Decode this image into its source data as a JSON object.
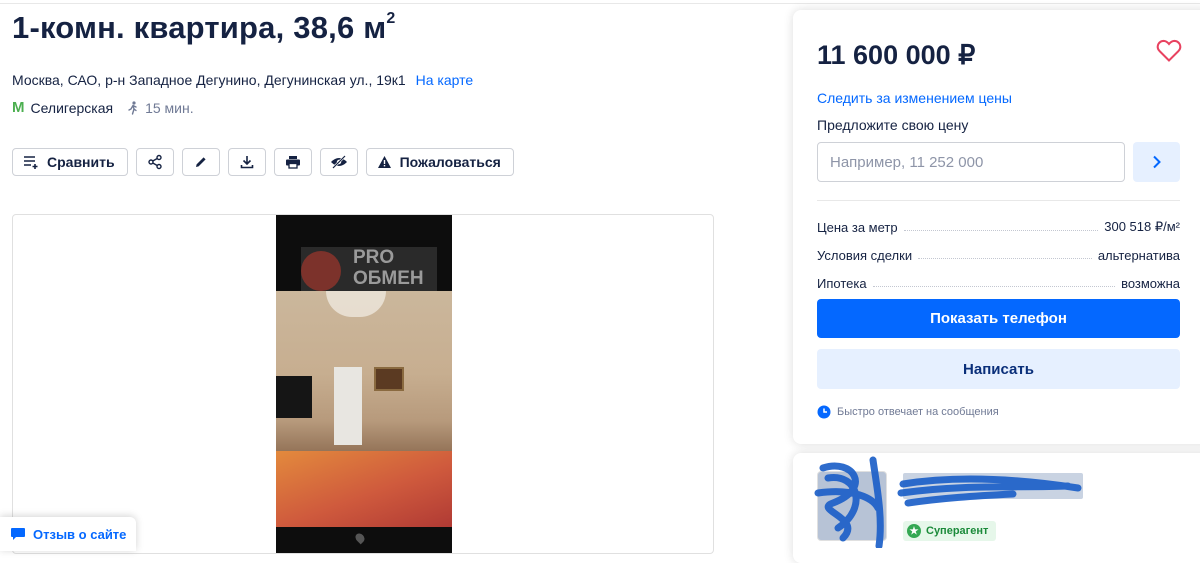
{
  "listing": {
    "title": "1-комн. квартира, 38,6 м",
    "title_sup": "2",
    "address": "Москва, САО, р-н Западное Дегунино, Дегунинская ул., 19к1",
    "map_link": "На карте",
    "metro_station": "Селигерская",
    "metro_time": "15 мин.",
    "metro_icon_letter": "М"
  },
  "toolbar": {
    "compare_label": "Сравнить",
    "report_label": "Пожаловаться"
  },
  "photo": {
    "logo_text_line1": "PRO",
    "logo_text_line2": "ОБМЕН"
  },
  "feedback": {
    "label": "Отзыв о сайте"
  },
  "sidebar": {
    "price": "11 600 000 ₽",
    "watch_price_link": "Следить за изменением цены",
    "offer_label": "Предложите свою цену",
    "offer_placeholder": "Например, 11 252 000",
    "params": [
      {
        "label": "Цена за метр",
        "value": "300 518 ₽/м²"
      },
      {
        "label": "Условия сделки",
        "value": "альтернатива"
      },
      {
        "label": "Ипотека",
        "value": "возможна"
      }
    ],
    "show_phone_button": "Показать телефон",
    "write_button": "Написать",
    "fast_reply_text": "Быстро отвечает на сообщения"
  },
  "agent": {
    "badge_label": "Суперагент"
  },
  "colors": {
    "accent": "#0468ff",
    "accent_light": "#e6f0ff",
    "text": "#152242",
    "heart": "#e84260",
    "metro": "#4caf50",
    "badge_green": "#34a853"
  },
  "icons": {
    "compare": "compare-list-icon",
    "share": "share-icon",
    "edit": "pencil-icon",
    "download": "download-icon",
    "print": "printer-icon",
    "hide": "eye-off-icon",
    "report": "warning-triangle-icon",
    "favorite": "heart-icon",
    "offer_submit": "chevron-right-icon",
    "fast_reply": "clock-icon",
    "walk": "walking-person-icon",
    "metro": "metro-icon"
  }
}
